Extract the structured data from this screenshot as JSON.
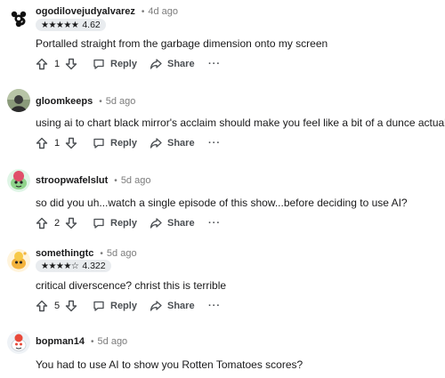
{
  "comments": [
    {
      "username": "ogodilovejudyalvarez",
      "time": "4d ago",
      "rating": {
        "stars": "★★★★★",
        "value": "4.62"
      },
      "avatar_icon": "spiral-avatar-icon",
      "body": "Portalled straight from the garbage dimension onto my screen",
      "votes": "1"
    },
    {
      "username": "gloomkeeps",
      "time": "5d ago",
      "avatar_icon": "photo-avatar-icon",
      "body": "using ai to chart black mirror's acclaim should make you feel like a bit of a dunce actually",
      "votes": "1"
    },
    {
      "username": "stroopwafelslut",
      "time": "5d ago",
      "avatar_icon": "snoo-avatar-icon",
      "body": "so did you uh...watch a single episode of this show...before deciding to use AI?",
      "votes": "2"
    },
    {
      "username": "somethingtc",
      "time": "5d ago",
      "rating": {
        "stars": "★★★★☆",
        "value": "4.322"
      },
      "avatar_icon": "snoo-avatar-icon",
      "body": "critical diverscence? christ this is terrible",
      "votes": "5"
    },
    {
      "username": "bopman14",
      "time": "5d ago",
      "avatar_icon": "snoo-avatar-icon",
      "body": "You had to use AI to show you Rotten Tomatoes scores?"
    }
  ],
  "actions": {
    "reply_label": "Reply",
    "share_label": "Share",
    "more_label": "···"
  },
  "colors": {
    "text": "#1a1a1b",
    "muted": "#7c7c7c",
    "action": "#4b4f53",
    "badge_bg": "#e9ecef"
  }
}
